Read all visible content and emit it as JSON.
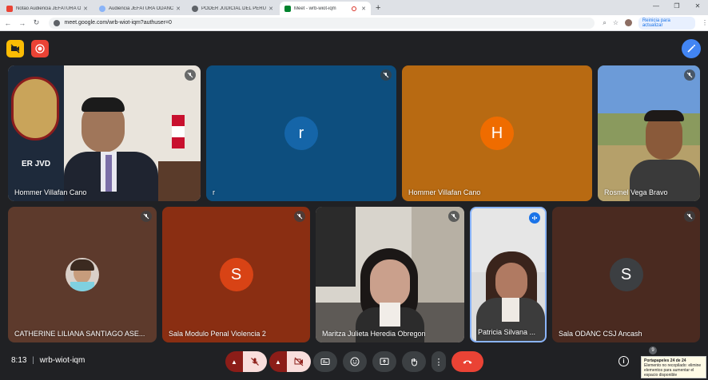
{
  "browser": {
    "tabs": [
      {
        "title": "Notao Audiencia JEFATURA O...",
        "favicon_color": "#ea4335",
        "active": false
      },
      {
        "title": "Audiencia JEFATURA ODANC c...",
        "favicon_color": "#8ab4f8",
        "active": false
      },
      {
        "title": "PODER JUDICIAL DEL PERU - C...",
        "favicon_color": "#5f6368",
        "active": false
      },
      {
        "title": "Meet - wrb-wiot-iqm",
        "favicon_color": "#00832d",
        "active": true
      }
    ],
    "url": "meet.google.com/wrb-wiot-iqm?authuser=0",
    "update_label": "Reinicia para actualizar"
  },
  "participants_row1": [
    {
      "name": "Hommer Villafan Cano",
      "kind": "video",
      "muted": true
    },
    {
      "name": "r",
      "kind": "avatar",
      "initial": "r",
      "bg": "#0d4e7e",
      "avatar_bg": "#1565a8",
      "muted": true
    },
    {
      "name": "Hommer Villafan Cano",
      "kind": "avatar",
      "initial": "H",
      "bg": "#b86a12",
      "avatar_bg": "#ef6c00",
      "muted": false
    },
    {
      "name": "Rosmel Vega Bravo",
      "kind": "video",
      "muted": true
    }
  ],
  "participants_row2": [
    {
      "name": "CATHERINE LILIANA SANTIAGO ASE...",
      "kind": "photo",
      "bg": "#5d3a2c",
      "muted": true
    },
    {
      "name": "Sala Modulo Penal Violencia 2",
      "kind": "avatar",
      "initial": "S",
      "bg": "#8a2e12",
      "avatar_bg": "#d84315",
      "muted": true
    },
    {
      "name": "Maritza Julieta Heredia Obregon",
      "kind": "video",
      "muted": true
    },
    {
      "name": "Patricia Silvana ...",
      "kind": "video",
      "muted": false,
      "speaking": true
    },
    {
      "name": "Sala ODANC CSJ Ancash",
      "kind": "avatar",
      "initial": "S",
      "bg": "#4a2a20",
      "avatar_bg": "#3c3f42",
      "muted": true
    }
  ],
  "meeting": {
    "time": "8:13",
    "code": "wrb-wiot-iqm",
    "participant_count": "9"
  },
  "notification": {
    "title": "Portapapeles 24 de 24",
    "body": "Elemento no recopilado: elimine elementos para aumentar el espacio disponible"
  },
  "colors": {
    "end_call": "#ea4335",
    "off_button": "#8c1d18",
    "control_bg": "#3c4043",
    "accent": "#1a73e8"
  }
}
